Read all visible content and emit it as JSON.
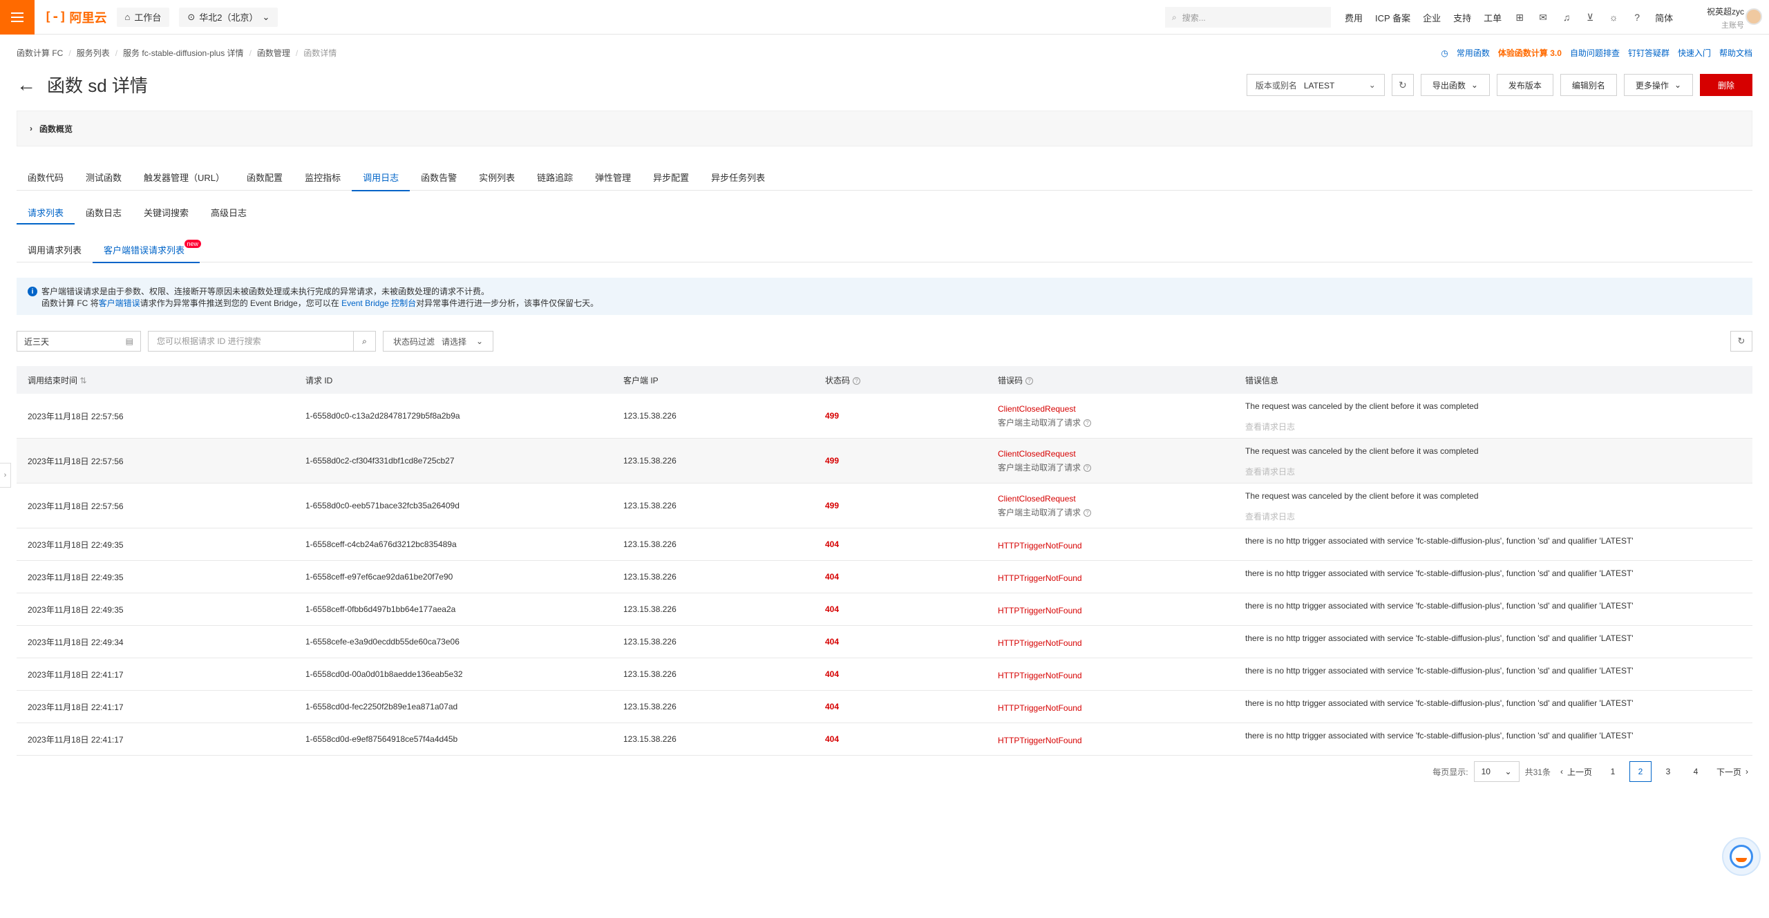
{
  "topbar": {
    "logo_text": "阿里云",
    "workbench": "工作台",
    "region": "华北2（北京）",
    "search_placeholder": "搜索...",
    "links": [
      "费用",
      "ICP 备案",
      "企业",
      "支持",
      "工单"
    ],
    "lang": "简体",
    "user_name": "祝英超zyc",
    "user_role": "主账号"
  },
  "breadcrumb": {
    "items": [
      "函数计算 FC",
      "服务列表",
      "服务 fc-stable-diffusion-plus 详情",
      "函数管理"
    ],
    "current": "函数详情"
  },
  "quick_links": {
    "functions": "常用函数",
    "try_fc3": "体验函数计算 3.0",
    "diagnose": "自助问题排查",
    "dingtalk": "钉钉答疑群",
    "quickstart": "快速入门",
    "help": "帮助文档"
  },
  "header": {
    "title": "函数 sd 详情",
    "version_label": "版本或别名",
    "version_value": "LATEST",
    "export_btn": "导出函数",
    "publish_btn": "发布版本",
    "edit_alias_btn": "编辑别名",
    "more_btn": "更多操作",
    "delete_btn": "删除"
  },
  "overview_label": "函数概览",
  "main_tabs": [
    "函数代码",
    "测试函数",
    "触发器管理（URL）",
    "函数配置",
    "监控指标",
    "调用日志",
    "函数告警",
    "实例列表",
    "链路追踪",
    "弹性管理",
    "异步配置",
    "异步任务列表"
  ],
  "sub_tabs": [
    "请求列表",
    "函数日志",
    "关键词搜索",
    "高级日志"
  ],
  "third_tabs": [
    "调用请求列表",
    "客户端错误请求列表"
  ],
  "new_badge": "new",
  "notice": {
    "line1": "客户端错误请求是由于参数、权限、连接断开等原因未被函数处理或未执行完成的异常请求，未被函数处理的请求不计费。",
    "line2_a": "函数计算 FC 将",
    "line2_link1": "客户端错误",
    "line2_b": "请求作为异常事件推送到您的 Event Bridge，您可以在 ",
    "line2_link2": "Event Bridge 控制台",
    "line2_c": "对异常事件进行进一步分析，该事件仅保留七天。"
  },
  "filters": {
    "date_range": "近三天",
    "search_placeholder": "您可以根据请求 ID 进行搜索",
    "status_label": "状态码过滤",
    "status_value": "请选择"
  },
  "table": {
    "headers": [
      "调用结束时间",
      "请求 ID",
      "客户端 IP",
      "状态码",
      "错误码",
      "错误信息"
    ],
    "view_log": "查看请求日志",
    "rows": [
      {
        "time": "2023年11月18日 22:57:56",
        "id": "1-6558d0c0-c13a2d284781729b5f8a2b9a",
        "ip": "123.15.38.226",
        "code": "499",
        "err": "ClientClosedRequest",
        "err_sub": "客户端主动取消了请求",
        "msg": "The request was canceled by the client before it was completed",
        "tall": true
      },
      {
        "time": "2023年11月18日 22:57:56",
        "id": "1-6558d0c2-cf304f331dbf1cd8e725cb27",
        "ip": "123.15.38.226",
        "code": "499",
        "err": "ClientClosedRequest",
        "err_sub": "客户端主动取消了请求",
        "msg": "The request was canceled by the client before it was completed",
        "tall": true
      },
      {
        "time": "2023年11月18日 22:57:56",
        "id": "1-6558d0c0-eeb571bace32fcb35a26409d",
        "ip": "123.15.38.226",
        "code": "499",
        "err": "ClientClosedRequest",
        "err_sub": "客户端主动取消了请求",
        "msg": "The request was canceled by the client before it was completed",
        "tall": true
      },
      {
        "time": "2023年11月18日 22:49:35",
        "id": "1-6558ceff-c4cb24a676d3212bc835489a",
        "ip": "123.15.38.226",
        "code": "404",
        "err": "HTTPTriggerNotFound",
        "msg": "there is no http trigger associated with service 'fc-stable-diffusion-plus', function 'sd' and qualifier 'LATEST'",
        "tall": false
      },
      {
        "time": "2023年11月18日 22:49:35",
        "id": "1-6558ceff-e97ef6cae92da61be20f7e90",
        "ip": "123.15.38.226",
        "code": "404",
        "err": "HTTPTriggerNotFound",
        "msg": "there is no http trigger associated with service 'fc-stable-diffusion-plus', function 'sd' and qualifier 'LATEST'",
        "tall": false
      },
      {
        "time": "2023年11月18日 22:49:35",
        "id": "1-6558ceff-0fbb6d497b1bb64e177aea2a",
        "ip": "123.15.38.226",
        "code": "404",
        "err": "HTTPTriggerNotFound",
        "msg": "there is no http trigger associated with service 'fc-stable-diffusion-plus', function 'sd' and qualifier 'LATEST'",
        "tall": false
      },
      {
        "time": "2023年11月18日 22:49:34",
        "id": "1-6558cefe-e3a9d0ecddb55de60ca73e06",
        "ip": "123.15.38.226",
        "code": "404",
        "err": "HTTPTriggerNotFound",
        "msg": "there is no http trigger associated with service 'fc-stable-diffusion-plus', function 'sd' and qualifier 'LATEST'",
        "tall": false
      },
      {
        "time": "2023年11月18日 22:41:17",
        "id": "1-6558cd0d-00a0d01b8aedde136eab5e32",
        "ip": "123.15.38.226",
        "code": "404",
        "err": "HTTPTriggerNotFound",
        "msg": "there is no http trigger associated with service 'fc-stable-diffusion-plus', function 'sd' and qualifier 'LATEST'",
        "tall": false
      },
      {
        "time": "2023年11月18日 22:41:17",
        "id": "1-6558cd0d-fec2250f2b89e1ea871a07ad",
        "ip": "123.15.38.226",
        "code": "404",
        "err": "HTTPTriggerNotFound",
        "msg": "there is no http trigger associated with service 'fc-stable-diffusion-plus', function 'sd' and qualifier 'LATEST'",
        "tall": false
      },
      {
        "time": "2023年11月18日 22:41:17",
        "id": "1-6558cd0d-e9ef87564918ce57f4a4d45b",
        "ip": "123.15.38.226",
        "code": "404",
        "err": "HTTPTriggerNotFound",
        "msg": "there is no http trigger associated with service 'fc-stable-diffusion-plus', function 'sd' and qualifier 'LATEST'",
        "tall": false
      }
    ]
  },
  "pager": {
    "per_page_label": "每页显示:",
    "per_page": "10",
    "total": "共31条",
    "prev": "上一页",
    "next": "下一页",
    "pages": [
      "1",
      "2",
      "3",
      "4"
    ],
    "current": "2"
  }
}
